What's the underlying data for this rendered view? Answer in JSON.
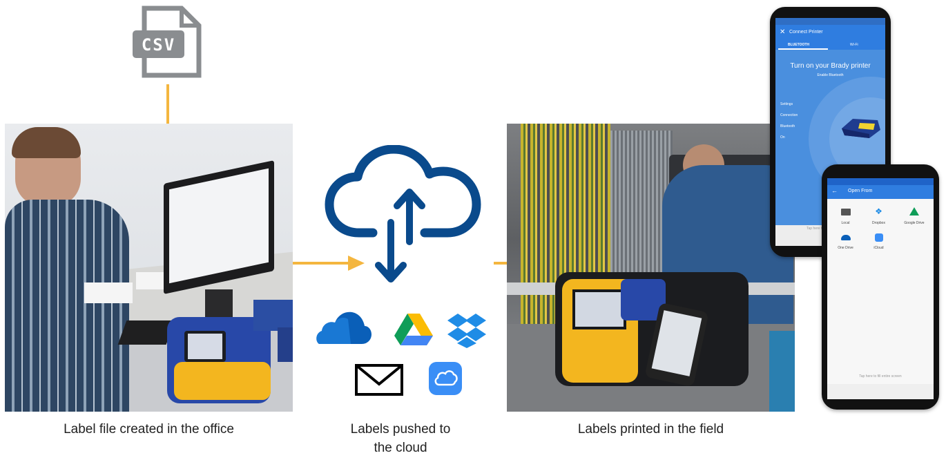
{
  "csv_icon": {
    "label": "CSV",
    "color": "#8a8d90"
  },
  "accent_arrow_color": "#f4b63f",
  "cloud_color": "#0a4a8c",
  "captions": {
    "office": "Label file created in the office",
    "cloud_line1": "Labels pushed to",
    "cloud_line2": "the cloud",
    "field": "Labels printed in the field"
  },
  "cloud_services": [
    "onedrive-icon",
    "google-drive-icon",
    "dropbox-icon",
    "mail-icon",
    "icloud-icon"
  ],
  "phone_connect": {
    "title": "Connect Printer",
    "tabs": [
      "BLUETOOTH",
      "Wi-Fi"
    ],
    "heading": "Turn on your Brady printer",
    "subheading": "Enable Bluetooth",
    "steps": [
      "Settings",
      "Connection",
      "Bluetooth",
      "On"
    ],
    "hint": "Tap here to"
  },
  "phone_open": {
    "title": "Open From",
    "items": [
      {
        "label": "Local",
        "icon": "folder-icon"
      },
      {
        "label": "Dropbox",
        "icon": "dropbox-icon"
      },
      {
        "label": "Google Drive",
        "icon": "google-drive-icon"
      },
      {
        "label": "One Drive",
        "icon": "onedrive-icon"
      },
      {
        "label": "iCloud",
        "icon": "icloud-icon"
      }
    ],
    "hint": "Tap here to fill entire screen"
  }
}
